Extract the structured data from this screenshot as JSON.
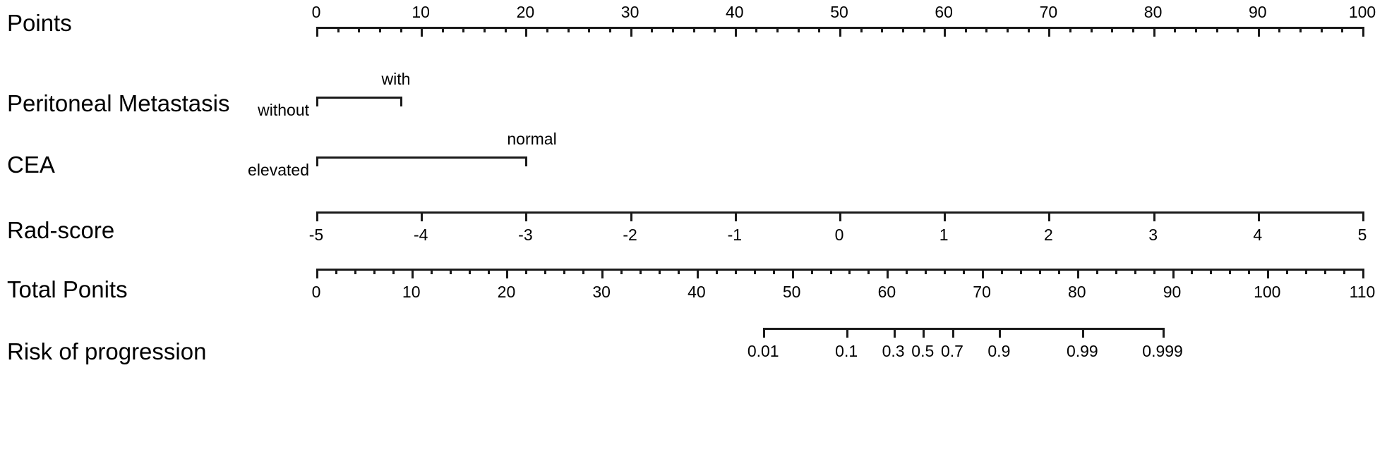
{
  "figure": {
    "type": "nomogram",
    "background": "#ffffff",
    "line_color": "#1a1a1a"
  },
  "chart_data": {
    "type": "table",
    "title": "",
    "xlabel": "",
    "ylabel": "",
    "grid": false,
    "legend": "none",
    "rows": [
      {
        "name": "points",
        "label": "Points",
        "kind": "numeric-axis",
        "axis_min": 0,
        "axis_max": 100,
        "major_step": 10,
        "minor_step": 2,
        "tick_labels": [
          "0",
          "10",
          "20",
          "30",
          "40",
          "50",
          "60",
          "70",
          "80",
          "90",
          "100"
        ],
        "tick_values": [
          0,
          10,
          20,
          30,
          40,
          50,
          60,
          70,
          80,
          90,
          100
        ],
        "tick_side": "below",
        "label_side": "above"
      },
      {
        "name": "peritoneal-metastasis",
        "label": "Peritoneal Metastasis",
        "kind": "categorical-axis",
        "categories": [
          "without",
          "with"
        ],
        "category_points": [
          0,
          8
        ],
        "axis_min": 0,
        "axis_max": 8,
        "label_sides": [
          "below",
          "above"
        ]
      },
      {
        "name": "cea",
        "label": "CEA",
        "kind": "categorical-axis",
        "categories": [
          "elevated",
          "normal"
        ],
        "category_points": [
          0,
          20
        ],
        "axis_min": 0,
        "axis_max": 20,
        "label_sides": [
          "below",
          "above"
        ]
      },
      {
        "name": "rad-score",
        "label": "Rad-score",
        "kind": "numeric-axis",
        "axis_min": -5,
        "axis_max": 5,
        "major_step": 1,
        "minor_step": 0,
        "tick_labels": [
          "-5",
          "-4",
          "-3",
          "-2",
          "-1",
          "0",
          "1",
          "2",
          "3",
          "4",
          "5"
        ],
        "tick_values": [
          -5,
          -4,
          -3,
          -2,
          -1,
          0,
          1,
          2,
          3,
          4,
          5
        ],
        "tick_side": "below",
        "label_side": "below"
      },
      {
        "name": "total-ponits",
        "label": "Total Ponits",
        "kind": "numeric-axis",
        "axis_min": 0,
        "axis_max": 110,
        "major_step": 10,
        "minor_step": 2,
        "tick_labels": [
          "0",
          "10",
          "20",
          "30",
          "40",
          "50",
          "60",
          "70",
          "80",
          "90",
          "100",
          "110"
        ],
        "tick_values": [
          0,
          10,
          20,
          30,
          40,
          50,
          60,
          70,
          80,
          90,
          100,
          110
        ],
        "tick_side": "below",
        "label_side": "below"
      },
      {
        "name": "risk-of-progression",
        "label": "Risk of progression",
        "kind": "probability-axis",
        "scale": "logit",
        "tick_labels": [
          "0.01",
          "0.1",
          "0.3",
          "0.5",
          "0.7",
          "0.9",
          "0.99",
          "0.999"
        ],
        "tick_values": [
          0.01,
          0.1,
          0.3,
          0.5,
          0.7,
          0.9,
          0.99,
          0.999
        ],
        "tick_side": "below",
        "label_side": "below",
        "total_points_span": [
          47.0,
          89.0
        ]
      }
    ]
  },
  "row_labels": {
    "points": "Points",
    "peritoneal_metastasis": "Peritoneal Metastasis",
    "cea": "CEA",
    "rad_score": "Rad-score",
    "total_ponits": "Total Ponits",
    "risk_of_progression": "Risk of progression"
  }
}
